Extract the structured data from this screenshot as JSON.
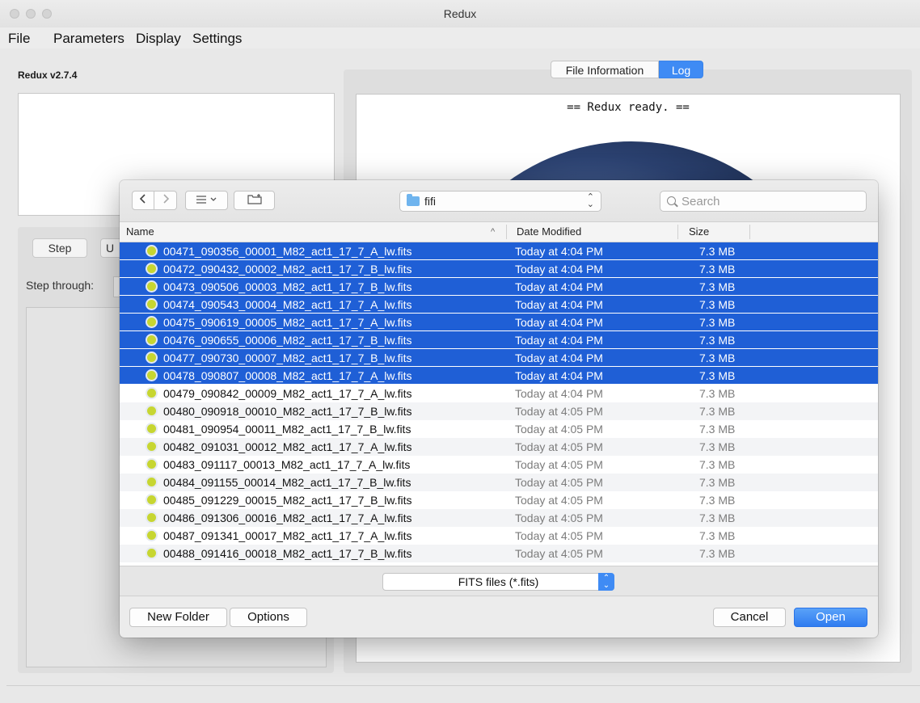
{
  "window": {
    "title": "Redux"
  },
  "menu": [
    "File",
    "Parameters",
    "Display",
    "Settings"
  ],
  "app": {
    "version": "Redux v2.7.4"
  },
  "left": {
    "step_label": "Step",
    "undo_label": "U",
    "step_through_label": "Step through:"
  },
  "tabs": {
    "file_info": "File Information",
    "log": "Log",
    "selected": "Log"
  },
  "log": {
    "text": "== Redux ready. =="
  },
  "dialog": {
    "location": "fifi",
    "search_placeholder": "Search",
    "columns": {
      "name": "Name",
      "date": "Date Modified",
      "size": "Size"
    },
    "sort_indicator": "^",
    "files": [
      {
        "name": "00471_090356_00001_M82_act1_17_7_A_lw.fits",
        "date": "Today at 4:04 PM",
        "size": "7.3 MB",
        "selected": true
      },
      {
        "name": "00472_090432_00002_M82_act1_17_7_B_lw.fits",
        "date": "Today at 4:04 PM",
        "size": "7.3 MB",
        "selected": true
      },
      {
        "name": "00473_090506_00003_M82_act1_17_7_B_lw.fits",
        "date": "Today at 4:04 PM",
        "size": "7.3 MB",
        "selected": true
      },
      {
        "name": "00474_090543_00004_M82_act1_17_7_A_lw.fits",
        "date": "Today at 4:04 PM",
        "size": "7.3 MB",
        "selected": true
      },
      {
        "name": "00475_090619_00005_M82_act1_17_7_A_lw.fits",
        "date": "Today at 4:04 PM",
        "size": "7.3 MB",
        "selected": true
      },
      {
        "name": "00476_090655_00006_M82_act1_17_7_B_lw.fits",
        "date": "Today at 4:04 PM",
        "size": "7.3 MB",
        "selected": true
      },
      {
        "name": "00477_090730_00007_M82_act1_17_7_B_lw.fits",
        "date": "Today at 4:04 PM",
        "size": "7.3 MB",
        "selected": true
      },
      {
        "name": "00478_090807_00008_M82_act1_17_7_A_lw.fits",
        "date": "Today at 4:04 PM",
        "size": "7.3 MB",
        "selected": true
      },
      {
        "name": "00479_090842_00009_M82_act1_17_7_A_lw.fits",
        "date": "Today at 4:04 PM",
        "size": "7.3 MB",
        "selected": false
      },
      {
        "name": "00480_090918_00010_M82_act1_17_7_B_lw.fits",
        "date": "Today at 4:05 PM",
        "size": "7.3 MB",
        "selected": false
      },
      {
        "name": "00481_090954_00011_M82_act1_17_7_B_lw.fits",
        "date": "Today at 4:05 PM",
        "size": "7.3 MB",
        "selected": false
      },
      {
        "name": "00482_091031_00012_M82_act1_17_7_A_lw.fits",
        "date": "Today at 4:05 PM",
        "size": "7.3 MB",
        "selected": false
      },
      {
        "name": "00483_091117_00013_M82_act1_17_7_A_lw.fits",
        "date": "Today at 4:05 PM",
        "size": "7.3 MB",
        "selected": false
      },
      {
        "name": "00484_091155_00014_M82_act1_17_7_B_lw.fits",
        "date": "Today at 4:05 PM",
        "size": "7.3 MB",
        "selected": false
      },
      {
        "name": "00485_091229_00015_M82_act1_17_7_B_lw.fits",
        "date": "Today at 4:05 PM",
        "size": "7.3 MB",
        "selected": false
      },
      {
        "name": "00486_091306_00016_M82_act1_17_7_A_lw.fits",
        "date": "Today at 4:05 PM",
        "size": "7.3 MB",
        "selected": false
      },
      {
        "name": "00487_091341_00017_M82_act1_17_7_A_lw.fits",
        "date": "Today at 4:05 PM",
        "size": "7.3 MB",
        "selected": false
      },
      {
        "name": "00488_091416_00018_M82_act1_17_7_B_lw.fits",
        "date": "Today at 4:05 PM",
        "size": "7.3 MB",
        "selected": false
      }
    ],
    "filter": "FITS files (*.fits)",
    "buttons": {
      "new_folder": "New Folder",
      "options": "Options",
      "cancel": "Cancel",
      "open": "Open"
    }
  },
  "colors": {
    "selection": "#1f5fd6",
    "accent": "#3f8bf4",
    "file_icon": "#c7d631"
  },
  "icons": [
    "back-arrow-icon",
    "forward-arrow-icon",
    "list-view-icon",
    "new-folder-icon",
    "folder-icon",
    "search-icon",
    "fits-file-icon"
  ]
}
